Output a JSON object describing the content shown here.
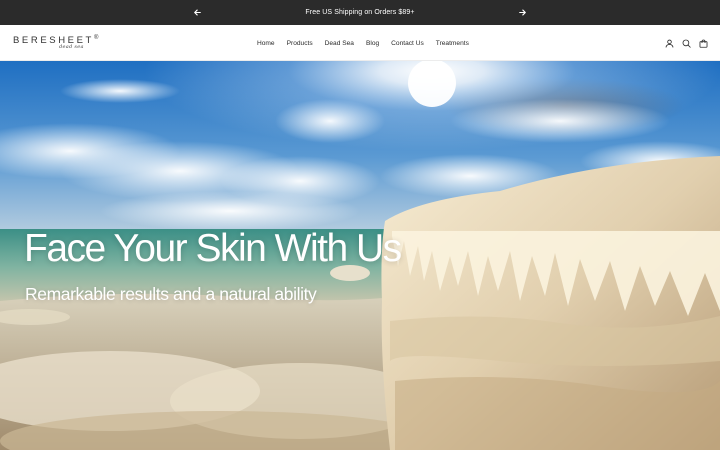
{
  "announcement": {
    "text": "Free US Shipping on Orders $89+",
    "prev_icon": "arrow-left-icon",
    "next_icon": "arrow-right-icon",
    "background": "#2b2b2b"
  },
  "header": {
    "logo_text": "BERESHEET",
    "logo_mark": "®",
    "logo_script": "dead sea",
    "nav": {
      "home": "Home",
      "products": "Products",
      "dead_sea": "Dead Sea",
      "blog": "Blog",
      "contact": "Contact Us",
      "treatments": "Treatments"
    },
    "icons": [
      "account-icon",
      "search-icon",
      "cart-icon"
    ]
  },
  "hero": {
    "title": "Face Your Skin With Us",
    "subtitle": "Remarkable results and a natural ability"
  }
}
